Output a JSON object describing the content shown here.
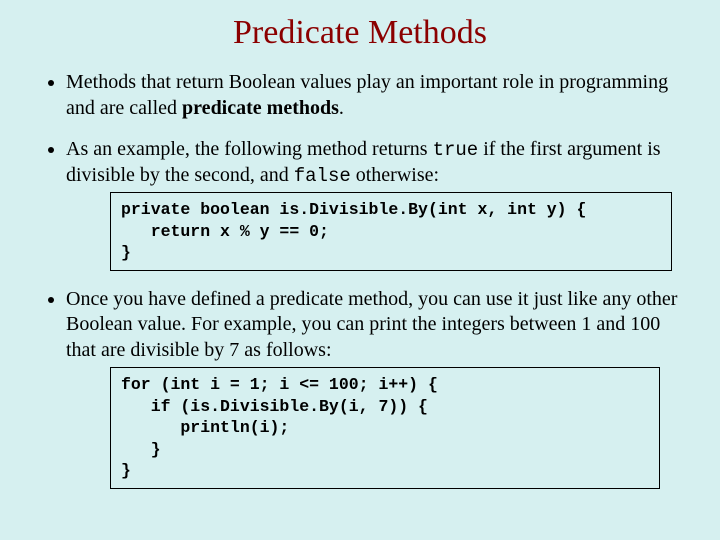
{
  "title": "Predicate Methods",
  "bullets": {
    "b1a": "Methods that return Boolean values play an important role in programming and are called ",
    "b1b": "predicate methods",
    "b1c": ".",
    "b2a": "As an example, the following method returns ",
    "b2true": "true",
    "b2b": " if the first argument is divisible by the second, and ",
    "b2false": "false",
    "b2c": " otherwise:",
    "b3": "Once you have defined a predicate method, you can use it just like any other Boolean value.  For example, you can print the integers between 1 and 100 that are divisible by 7 as follows:"
  },
  "code1": "private boolean is.Divisible.By(int x, int y) {\n   return x % y == 0;\n}",
  "code2": "for (int i = 1; i <= 100; i++) {\n   if (is.Divisible.By(i, 7)) {\n      println(i);\n   }\n}"
}
